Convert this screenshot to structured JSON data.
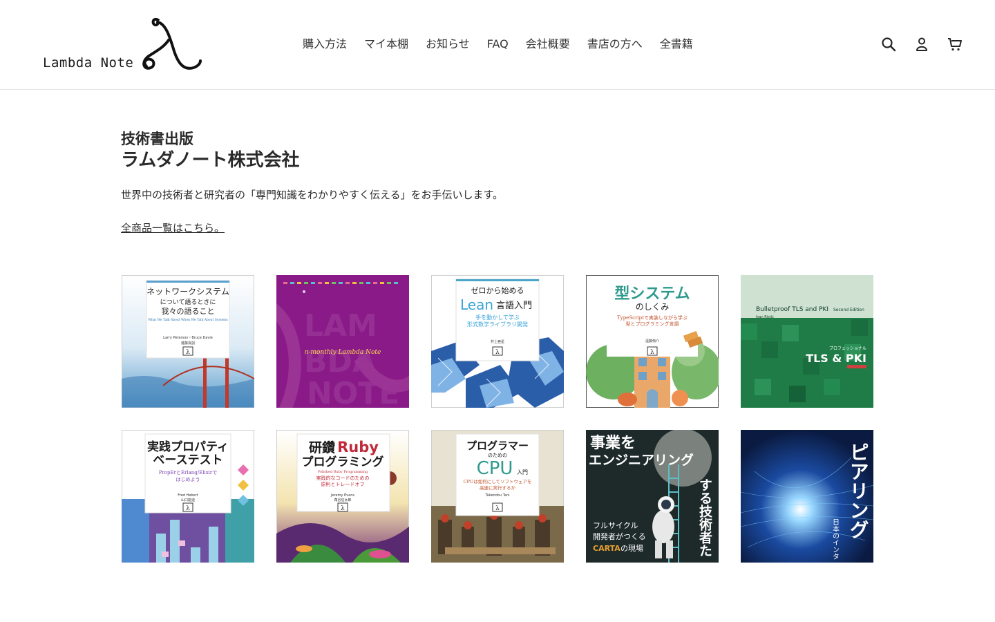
{
  "header": {
    "logo_text": "Lambda Note",
    "nav": [
      {
        "label": "購入方法"
      },
      {
        "label": "マイ本棚"
      },
      {
        "label": "お知らせ"
      },
      {
        "label": "FAQ"
      },
      {
        "label": "会社概要"
      },
      {
        "label": "書店の方へ"
      },
      {
        "label": "全書籍"
      }
    ],
    "icons": [
      "search-icon",
      "account-icon",
      "cart-icon"
    ]
  },
  "hero": {
    "subtitle": "技術書出版",
    "title": "ラムダノート株式会社",
    "description": "世界中の技術者と研究者の「専門知識をわかりやすく伝える」をお手伝いします。",
    "link_label": "全商品一覧はこちら。"
  },
  "books": [
    {
      "id": "book-network-systems",
      "title": "ネットワークシステム",
      "title2": "について語るときに",
      "title3": "我々の語ること",
      "en": "What We Talk About When We Talk About Systems",
      "authors": "Larry Peterson・Bruce Davie",
      "translator": "進藤資訓"
    },
    {
      "id": "book-n-monthly",
      "caption": "n-monthly Lambda Note"
    },
    {
      "id": "book-lean",
      "pre": "ゼロから始める",
      "title": "Lean",
      "title_suffix": "言語入門",
      "sub": "手を動かして学ぶ",
      "sub2": "形式数学ライブラリ開発",
      "author": "井上亜星"
    },
    {
      "id": "book-type-system",
      "title": "型システム",
      "title2": "のしくみ",
      "sub": "TypeScriptで実装しながら学ぶ",
      "sub2": "型とプログラミング言語",
      "author": "遠藤侑介"
    },
    {
      "id": "book-tls-pki",
      "en_title": "Bulletproof TLS and PKI",
      "edition": "Second Edition",
      "author": "Ivan Ristić",
      "pro": "プロフェッショナル",
      "title": "TLS & PKI"
    },
    {
      "id": "book-property-test",
      "title": "実践プロパティ",
      "title2": "ベーステスト",
      "sub": "PropErとErlang/Elixirで",
      "sub2": "はじめよう",
      "author": "Fred Hebert",
      "translator": "山口能迪"
    },
    {
      "id": "book-ruby",
      "title_ja": "研鑽",
      "title_en": "Ruby",
      "title2": "プログラミング",
      "sub_en": "Polished Ruby Programming",
      "sub": "実践的なコードのための",
      "sub2": "原則とトレードオフ",
      "author": "Jeremy Evans",
      "translator": "角谷信太郎"
    },
    {
      "id": "book-cpu",
      "title": "プログラマー",
      "title_mid": "のための",
      "title2": "CPU",
      "title2_suffix": "入門",
      "sub": "CPUは如何にしてソフトウェアを",
      "sub2": "高速に実行するか",
      "author": "Takenobu Tani"
    },
    {
      "id": "book-carta",
      "title": "事業を",
      "title2": "エンジニアリング",
      "title3": "する技術者た",
      "sub": "フルサイクル",
      "sub2": "開発者がつくる",
      "sub3_brand": "CARTA",
      "sub3": "の現場"
    },
    {
      "id": "book-peering",
      "title": "ピアリング",
      "sub": "日本のインタ"
    }
  ],
  "colors": {
    "text": "#2a2a2a",
    "accent_teal": "#2f9a8c",
    "purple_cover": "#8c1a8a",
    "green_cover": "#1d7a45",
    "dark_cover": "#1e2a2a",
    "blue_cover": "#0b1a4a"
  }
}
